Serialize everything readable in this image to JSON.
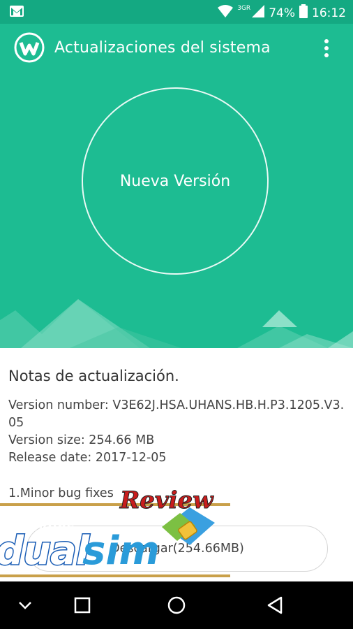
{
  "status_bar": {
    "network": "3GR",
    "battery": "74%",
    "time": "16:12",
    "icons": [
      "gmail-icon",
      "wifi-icon",
      "signal-icon",
      "battery-icon"
    ]
  },
  "toolbar": {
    "title": "Actualizaciones del sistema",
    "menu_icon": "more-vert-icon"
  },
  "hero": {
    "circle_label": "Nueva Versión"
  },
  "notes": {
    "title": "Notas de actualización.",
    "version_number": "Version number: V3E62J.HSA.UHANS.HB.H.P3.1205.V3.05",
    "version_size": "Version size: 254.66 MB",
    "release_date": "Release date: 2017-12-05",
    "fixes": "1.Minor bug fixes",
    "download_label": "Descargar(254.66MB)"
  },
  "watermark": {
    "moviles": "móviles",
    "dual": "dual",
    "sim": "sim",
    "review": "Review"
  },
  "nav_bar": {
    "icons": [
      "collapse-icon",
      "recents-icon",
      "home-icon",
      "back-icon"
    ]
  },
  "colors": {
    "primary": "#1dbc92",
    "status_bar": "#14a982",
    "text": "#444444"
  }
}
